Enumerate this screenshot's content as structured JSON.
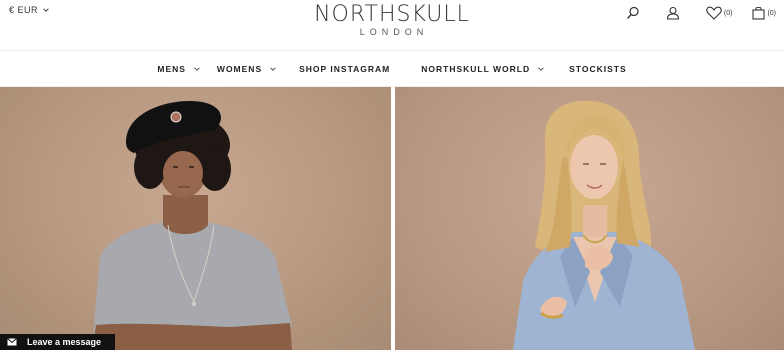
{
  "header": {
    "currency": "€ EUR",
    "logo_main": "NORTHSKULL",
    "logo_sub": "LONDON",
    "wishlist_count": "(0)",
    "cart_count": "(0)"
  },
  "nav": {
    "items": [
      {
        "label": "MENS",
        "dropdown": true
      },
      {
        "label": "WOMENS",
        "dropdown": true
      },
      {
        "label": "SHOP INSTAGRAM",
        "dropdown": false
      },
      {
        "label": "NORTHSKULL WORLD",
        "dropdown": true
      },
      {
        "label": "STOCKISTS",
        "dropdown": false
      }
    ]
  },
  "chat": {
    "label": "Leave a message"
  },
  "icons": {
    "currency_chevron": "chevron-down-icon",
    "search": "search-icon",
    "account": "user-icon",
    "wishlist": "heart-icon",
    "cart": "bag-icon",
    "chat": "envelope-icon"
  },
  "colors": {
    "background": "#ffffff",
    "hero_backdrop": "#b99a82",
    "chat_bar": "#111111"
  }
}
